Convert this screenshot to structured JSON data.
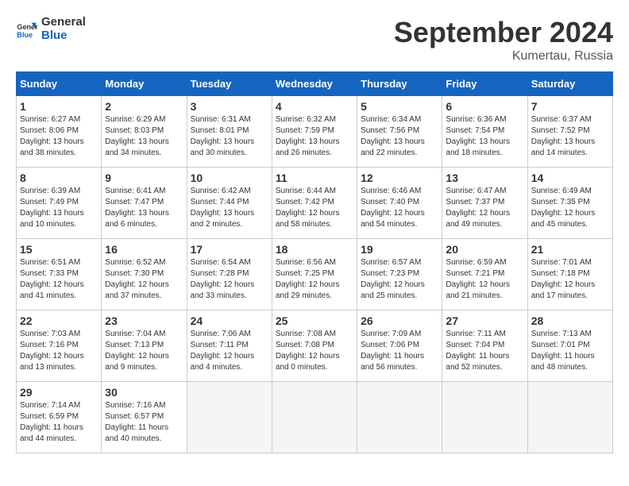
{
  "logo": {
    "line1": "General",
    "line2": "Blue"
  },
  "title": "September 2024",
  "location": "Kumertau, Russia",
  "weekdays": [
    "Sunday",
    "Monday",
    "Tuesday",
    "Wednesday",
    "Thursday",
    "Friday",
    "Saturday"
  ],
  "weeks": [
    [
      {
        "day": "1",
        "info": "Sunrise: 6:27 AM\nSunset: 8:06 PM\nDaylight: 13 hours\nand 38 minutes."
      },
      {
        "day": "2",
        "info": "Sunrise: 6:29 AM\nSunset: 8:03 PM\nDaylight: 13 hours\nand 34 minutes."
      },
      {
        "day": "3",
        "info": "Sunrise: 6:31 AM\nSunset: 8:01 PM\nDaylight: 13 hours\nand 30 minutes."
      },
      {
        "day": "4",
        "info": "Sunrise: 6:32 AM\nSunset: 7:59 PM\nDaylight: 13 hours\nand 26 minutes."
      },
      {
        "day": "5",
        "info": "Sunrise: 6:34 AM\nSunset: 7:56 PM\nDaylight: 13 hours\nand 22 minutes."
      },
      {
        "day": "6",
        "info": "Sunrise: 6:36 AM\nSunset: 7:54 PM\nDaylight: 13 hours\nand 18 minutes."
      },
      {
        "day": "7",
        "info": "Sunrise: 6:37 AM\nSunset: 7:52 PM\nDaylight: 13 hours\nand 14 minutes."
      }
    ],
    [
      {
        "day": "8",
        "info": "Sunrise: 6:39 AM\nSunset: 7:49 PM\nDaylight: 13 hours\nand 10 minutes."
      },
      {
        "day": "9",
        "info": "Sunrise: 6:41 AM\nSunset: 7:47 PM\nDaylight: 13 hours\nand 6 minutes."
      },
      {
        "day": "10",
        "info": "Sunrise: 6:42 AM\nSunset: 7:44 PM\nDaylight: 13 hours\nand 2 minutes."
      },
      {
        "day": "11",
        "info": "Sunrise: 6:44 AM\nSunset: 7:42 PM\nDaylight: 12 hours\nand 58 minutes."
      },
      {
        "day": "12",
        "info": "Sunrise: 6:46 AM\nSunset: 7:40 PM\nDaylight: 12 hours\nand 54 minutes."
      },
      {
        "day": "13",
        "info": "Sunrise: 6:47 AM\nSunset: 7:37 PM\nDaylight: 12 hours\nand 49 minutes."
      },
      {
        "day": "14",
        "info": "Sunrise: 6:49 AM\nSunset: 7:35 PM\nDaylight: 12 hours\nand 45 minutes."
      }
    ],
    [
      {
        "day": "15",
        "info": "Sunrise: 6:51 AM\nSunset: 7:33 PM\nDaylight: 12 hours\nand 41 minutes."
      },
      {
        "day": "16",
        "info": "Sunrise: 6:52 AM\nSunset: 7:30 PM\nDaylight: 12 hours\nand 37 minutes."
      },
      {
        "day": "17",
        "info": "Sunrise: 6:54 AM\nSunset: 7:28 PM\nDaylight: 12 hours\nand 33 minutes."
      },
      {
        "day": "18",
        "info": "Sunrise: 6:56 AM\nSunset: 7:25 PM\nDaylight: 12 hours\nand 29 minutes."
      },
      {
        "day": "19",
        "info": "Sunrise: 6:57 AM\nSunset: 7:23 PM\nDaylight: 12 hours\nand 25 minutes."
      },
      {
        "day": "20",
        "info": "Sunrise: 6:59 AM\nSunset: 7:21 PM\nDaylight: 12 hours\nand 21 minutes."
      },
      {
        "day": "21",
        "info": "Sunrise: 7:01 AM\nSunset: 7:18 PM\nDaylight: 12 hours\nand 17 minutes."
      }
    ],
    [
      {
        "day": "22",
        "info": "Sunrise: 7:03 AM\nSunset: 7:16 PM\nDaylight: 12 hours\nand 13 minutes."
      },
      {
        "day": "23",
        "info": "Sunrise: 7:04 AM\nSunset: 7:13 PM\nDaylight: 12 hours\nand 9 minutes."
      },
      {
        "day": "24",
        "info": "Sunrise: 7:06 AM\nSunset: 7:11 PM\nDaylight: 12 hours\nand 4 minutes."
      },
      {
        "day": "25",
        "info": "Sunrise: 7:08 AM\nSunset: 7:08 PM\nDaylight: 12 hours\nand 0 minutes."
      },
      {
        "day": "26",
        "info": "Sunrise: 7:09 AM\nSunset: 7:06 PM\nDaylight: 11 hours\nand 56 minutes."
      },
      {
        "day": "27",
        "info": "Sunrise: 7:11 AM\nSunset: 7:04 PM\nDaylight: 11 hours\nand 52 minutes."
      },
      {
        "day": "28",
        "info": "Sunrise: 7:13 AM\nSunset: 7:01 PM\nDaylight: 11 hours\nand 48 minutes."
      }
    ],
    [
      {
        "day": "29",
        "info": "Sunrise: 7:14 AM\nSunset: 6:59 PM\nDaylight: 11 hours\nand 44 minutes."
      },
      {
        "day": "30",
        "info": "Sunrise: 7:16 AM\nSunset: 6:57 PM\nDaylight: 11 hours\nand 40 minutes."
      },
      {
        "day": "",
        "info": ""
      },
      {
        "day": "",
        "info": ""
      },
      {
        "day": "",
        "info": ""
      },
      {
        "day": "",
        "info": ""
      },
      {
        "day": "",
        "info": ""
      }
    ]
  ]
}
